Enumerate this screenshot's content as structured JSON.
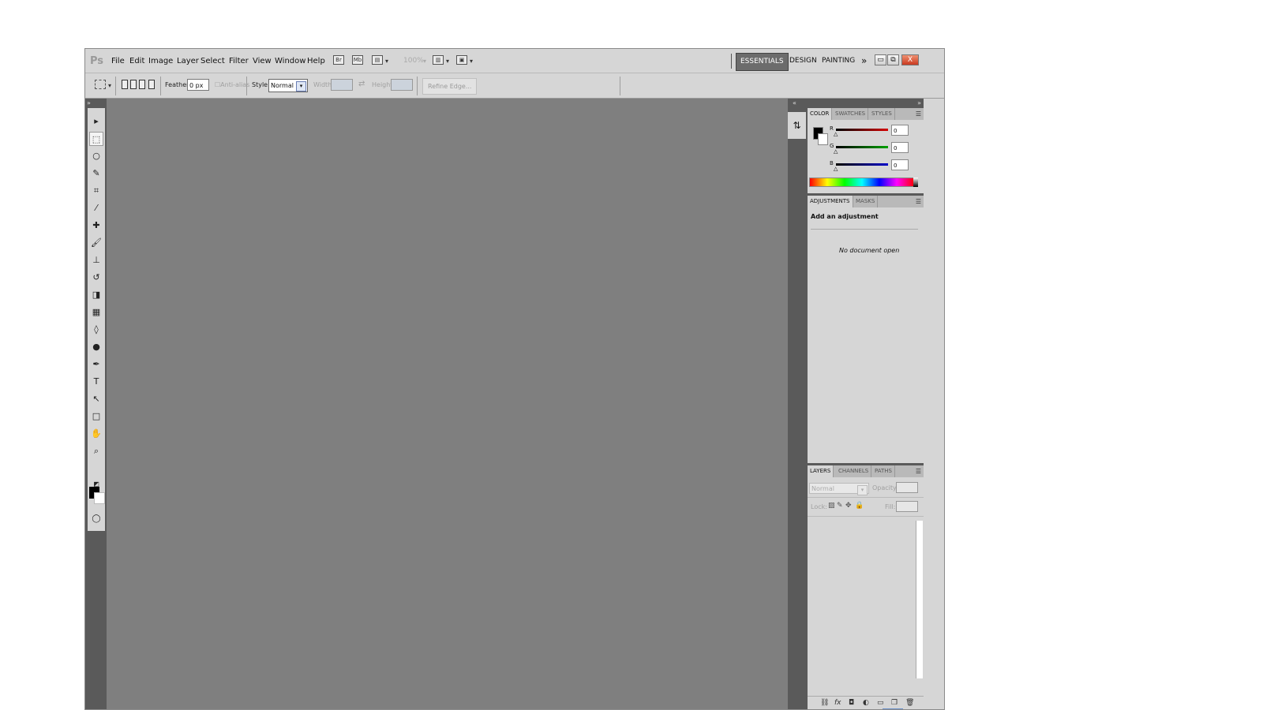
{
  "app": {
    "logo": "Ps",
    "menu": [
      "File",
      "Edit",
      "Image",
      "Layer",
      "Select",
      "Filter",
      "View",
      "Window",
      "Help"
    ],
    "zoom": "100%",
    "workspaces": [
      "ESSENTIALS",
      "DESIGN",
      "PAINTING"
    ],
    "more_workspaces": "»",
    "window_controls": {
      "minimize": "▭",
      "restore": "⧉",
      "close": "X"
    }
  },
  "options_bar": {
    "feather_label": "Feather:",
    "feather_value": "0 px",
    "antialias_label": "Anti-alias",
    "style_label": "Style:",
    "style_value": "Normal",
    "width_label": "Width:",
    "height_label": "Height:",
    "swap_icon": "⇄",
    "refine_edge": "Refine Edge..."
  },
  "tools": [
    {
      "name": "move-tool-icon",
      "glyph": "▸"
    },
    {
      "name": "marquee-tool-icon",
      "glyph": "⬚"
    },
    {
      "name": "lasso-tool-icon",
      "glyph": "○"
    },
    {
      "name": "quick-select-tool-icon",
      "glyph": "✎"
    },
    {
      "name": "crop-tool-icon",
      "glyph": "⌗"
    },
    {
      "name": "eyedropper-tool-icon",
      "glyph": "⁄"
    },
    {
      "name": "healing-brush-tool-icon",
      "glyph": "✚"
    },
    {
      "name": "brush-tool-icon",
      "glyph": "🖌"
    },
    {
      "name": "clone-stamp-tool-icon",
      "glyph": "⊥"
    },
    {
      "name": "history-brush-tool-icon",
      "glyph": "↺"
    },
    {
      "name": "eraser-tool-icon",
      "glyph": "◨"
    },
    {
      "name": "gradient-tool-icon",
      "glyph": "▦"
    },
    {
      "name": "blur-tool-icon",
      "glyph": "◊"
    },
    {
      "name": "dodge-tool-icon",
      "glyph": "●"
    },
    {
      "name": "pen-tool-icon",
      "glyph": "✒"
    },
    {
      "name": "type-tool-icon",
      "glyph": "T"
    },
    {
      "name": "path-select-tool-icon",
      "glyph": "↖"
    },
    {
      "name": "shape-tool-icon",
      "glyph": "□"
    },
    {
      "name": "hand-tool-icon",
      "glyph": "✋"
    },
    {
      "name": "zoom-tool-icon",
      "glyph": "⌕"
    }
  ],
  "color_panel": {
    "tabs": [
      "COLOR",
      "SWATCHES",
      "STYLES"
    ],
    "channels": [
      {
        "label": "R",
        "value": "0",
        "color": "#d40000"
      },
      {
        "label": "G",
        "value": "0",
        "color": "#00a000"
      },
      {
        "label": "B",
        "value": "0",
        "color": "#0000c8"
      }
    ]
  },
  "adjustments_panel": {
    "tabs": [
      "ADJUSTMENTS",
      "MASKS"
    ],
    "heading": "Add an adjustment",
    "empty_message": "No document open"
  },
  "layers_panel": {
    "tabs": [
      "LAYERS",
      "CHANNELS",
      "PATHS"
    ],
    "blend_mode": "Normal",
    "opacity_label": "Opacity:",
    "lock_label": "Lock:",
    "fill_label": "Fill:"
  },
  "colors": {
    "canvas": "#7f7f7f",
    "chrome": "#d6d6d6",
    "dark_strip": "#5a5a5a"
  }
}
